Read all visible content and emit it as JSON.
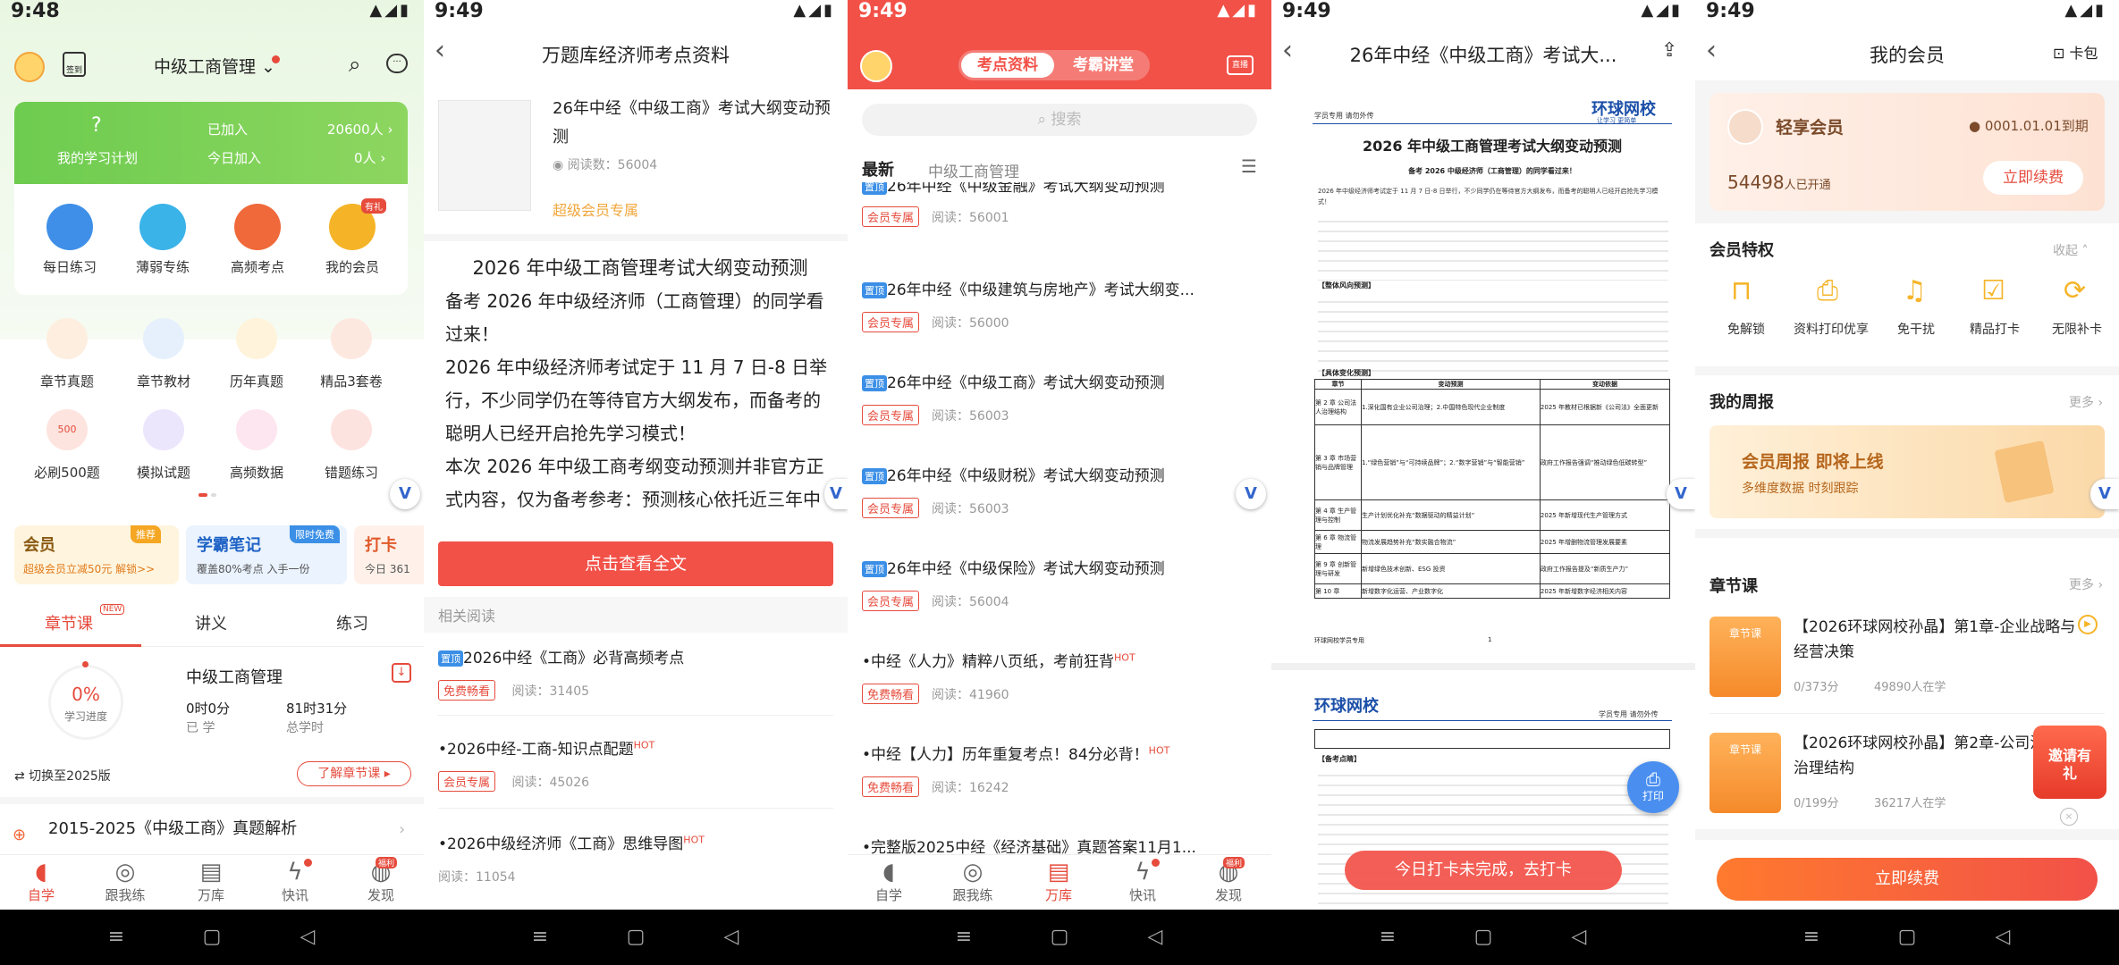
{
  "colors": {
    "red": "#f25148",
    "green": "#5fc54b",
    "orange": "#f08a24",
    "blue": "#3b8fe6"
  },
  "p1": {
    "status_time": "9:48",
    "title": "中级工商管理",
    "sign": "签到",
    "study_plan_label": "我的学习计划",
    "added_label": "已加入",
    "added_value": "20600人",
    "today_label": "今日加入",
    "today_value": "0人",
    "quick": [
      {
        "label": "每日练习",
        "icon": "clock-icon"
      },
      {
        "label": "薄弱专练",
        "icon": "chat-icon"
      },
      {
        "label": "高频考点",
        "icon": "book-icon"
      },
      {
        "label": "我的会员",
        "icon": "crown-icon",
        "badge": "有礼"
      }
    ],
    "grid": [
      {
        "label": "章节真题"
      },
      {
        "label": "章节教材"
      },
      {
        "label": "历年真题"
      },
      {
        "label": "精品3套卷"
      },
      {
        "label": "必刷500题",
        "icon_text": "500"
      },
      {
        "label": "模拟试题"
      },
      {
        "label": "高频数据"
      },
      {
        "label": "错题练习"
      }
    ],
    "promo": [
      {
        "title": "会员",
        "sub": "超级会员立减50元 解锁>>",
        "badge": "推荐"
      },
      {
        "title": "学霸笔记",
        "sub": "覆盖80%考点 入手一份",
        "badge": "限时免费"
      },
      {
        "title": "打卡",
        "sub": "今日 361"
      }
    ],
    "tabs": [
      {
        "label": "章节课",
        "badge": "NEW"
      },
      {
        "label": "讲义"
      },
      {
        "label": "练习"
      }
    ],
    "progress_value": "0%",
    "progress_label": "学习进度",
    "course_title": "中级工商管理",
    "studied_time": "0时0分",
    "studied_label": "已 学",
    "total_time": "81时31分",
    "total_label": "总学时",
    "switch": "⇄ 切换至2025版",
    "learn_btn": "了解章节课",
    "list_item": "2015-2025《中级工商》真题解析",
    "bottom_tabs": [
      "自学",
      "跟我练",
      "万库",
      "快讯",
      "发现"
    ],
    "discover_badge": "福利"
  },
  "p2": {
    "status_time": "9:49",
    "title": "万题库经济师考点资料",
    "article_title": "26年中经《中级工商》考试大纲变动预测",
    "reads": "阅读数：56004",
    "exclusive": "超级会员专属",
    "body_title": "2026 年中级工商管理考试大纲变动预测",
    "body": [
      "备考 2026 年中级经济师（工商管理）的同学看过来！",
      "2026 年中级经济师考试定于 11 月 7 日-8 日举行，不少同学仍在等待官方大纲发布，而备考的聪明人已经开启抢先学习模式！",
      "本次 2026 年中级工商考纲变动预测并非官方正式内容，仅为备考参考：预测核心依托近三年中"
    ],
    "view_full": "点击查看全文",
    "related": "相关阅读",
    "rel": [
      {
        "prefix": "置顶",
        "title": "2026中经《工商》必背高频考点",
        "tag": "免费畅看",
        "reads": "阅读：31405",
        "hot": ""
      },
      {
        "prefix": "",
        "title": "2026中经-工商-知识点配题",
        "tag": "会员专属",
        "reads": "阅读：45026",
        "hot": "HOT"
      },
      {
        "prefix": "",
        "title": "2026中级经济师《工商》思维导图",
        "tag": "",
        "reads": "阅读：11054",
        "hot": "HOT"
      }
    ]
  },
  "p3": {
    "status_time": "9:49",
    "tab_active": "考点资料",
    "tab_other": "考霸讲堂",
    "live": "直播",
    "search_placeholder": "搜索",
    "filter_latest": "最新",
    "filter_cat": "中级工商管理",
    "items": [
      {
        "title": "26年中经《中级金融》考试大纲变动预测",
        "tag": "会员专属",
        "reads": "阅读：56001"
      },
      {
        "title": "26年中经《中级建筑与房地产》考试大纲变...",
        "tag": "会员专属",
        "reads": "阅读：56000"
      },
      {
        "title": "26年中经《中级工商》考试大纲变动预测",
        "tag": "会员专属",
        "reads": "阅读：56003"
      },
      {
        "title": "26年中经《中级财税》考试大纲变动预测",
        "tag": "会员专属",
        "reads": "阅读：56003"
      },
      {
        "title": "26年中经《中级保险》考试大纲变动预测",
        "tag": "会员专属",
        "reads": "阅读：56004"
      }
    ],
    "items2": [
      {
        "title": "中经《人力》精粹八页纸，考前狂背",
        "tag": "免费畅看",
        "reads": "阅读：41960"
      },
      {
        "title": "中经【人力】历年重复考点！84分必背！",
        "tag": "免费畅看",
        "reads": "阅读：16242"
      },
      {
        "title": "完整版2025中经《经济基础》真题答案11月1...",
        "tag": "",
        "reads": ""
      }
    ],
    "prefix": "置顶",
    "hot": "HOT",
    "bottom_tabs": [
      "自学",
      "跟我练",
      "万库",
      "快讯",
      "发现"
    ],
    "discover_badge": "福利"
  },
  "p4": {
    "status_time": "9:49",
    "title": "26年中经《中级工商》考试大...",
    "brand": "环球网校",
    "brand_sub": "让学习 更简单",
    "header_left": "学员专用  请勿外传",
    "doc_title": "2026 年中级工商管理考试大纲变动预测",
    "doc_sub": "备考 2026 中级经济师（工商管理）的同学看过来！",
    "doc_para": "2026 年中级经济师考试定于 11 月 7 日-8 日举行，不少同学仍在等待官方大纲发布，而备考的聪明人已经开启抢先学习模式！",
    "sec1": "【整体风向预测】",
    "sec2": "【具体变化预测】",
    "table_head": [
      "章节",
      "变动预测",
      "变动依据"
    ],
    "table_rows": [
      [
        "第 2 章 公司法人治理结构",
        "1.深化国有企业公司治理；2.中国特色现代企业制度",
        "2025 年教材已根据新《公司法》全面更新"
      ],
      [
        "第 3 章 市场营销与品牌管理",
        "1.“绿色营销”与“可持续品牌”；2.“数字营销”与“智能营销”",
        "政府工作报告强调“推动绿色低碳转型”"
      ],
      [
        "第 4 章 生产管理与控制",
        "生产计划优化补充“数据驱动的精益计划”",
        "2025 年新增现代生产管理方式"
      ],
      [
        "第 6 章 物流管理",
        "物流发展趋势补充“数实融合物流”",
        "2025 年增删物流管理发展要素"
      ],
      [
        "第 9 章 创新管理与研发",
        "新增绿色技术创新、ESG 投资",
        "政府工作报告提及“新质生产力”"
      ],
      [
        "第 10 章",
        "新增数字化运营、产业数字化",
        "2025 年新增数字经济相关内容"
      ]
    ],
    "footer": "环球网校学员专用",
    "page_no": "1",
    "page2_head": "学员专用  请勿外传",
    "page2_sec": "【备考点睛】",
    "print": "打印",
    "toast": "今日打卡未完成，去打卡"
  },
  "p5": {
    "status_time": "9:49",
    "title": "我的会员",
    "card_pack": "卡包",
    "member_name": "轻享会员",
    "expire": "0001.01.01到期",
    "opened_count": "54498",
    "opened_suffix": "人已开通",
    "renew": "立即续费",
    "privileges_title": "会员特权",
    "collapse": "收起",
    "privileges": [
      {
        "label": "免解锁",
        "icon": "unlock-icon"
      },
      {
        "label": "资料打印优享",
        "icon": "printer-icon"
      },
      {
        "label": "免干扰",
        "icon": "bell-off-icon"
      },
      {
        "label": "精品打卡",
        "icon": "calendar-check-icon"
      },
      {
        "label": "无限补卡",
        "icon": "repeat-icon"
      }
    ],
    "weekly_title": "我的周报",
    "more": "更多",
    "weekly_banner": "会员周报 即将上线",
    "weekly_sub": "多维度数据 时刻跟踪",
    "chapter_title": "章节课",
    "courses": [
      {
        "thumb": "章节课",
        "title": "【2026环球网校孙晶】第1章-企业战略与经营决策",
        "progress": "0/373分",
        "students": "49890人在学"
      },
      {
        "thumb": "章节课",
        "title": "【2026环球网校孙晶】第2章-公司法人治理结构",
        "progress": "0/199分",
        "students": "36217人在学"
      }
    ],
    "invite": "邀请有礼",
    "renew_bottom": "立即续费"
  }
}
